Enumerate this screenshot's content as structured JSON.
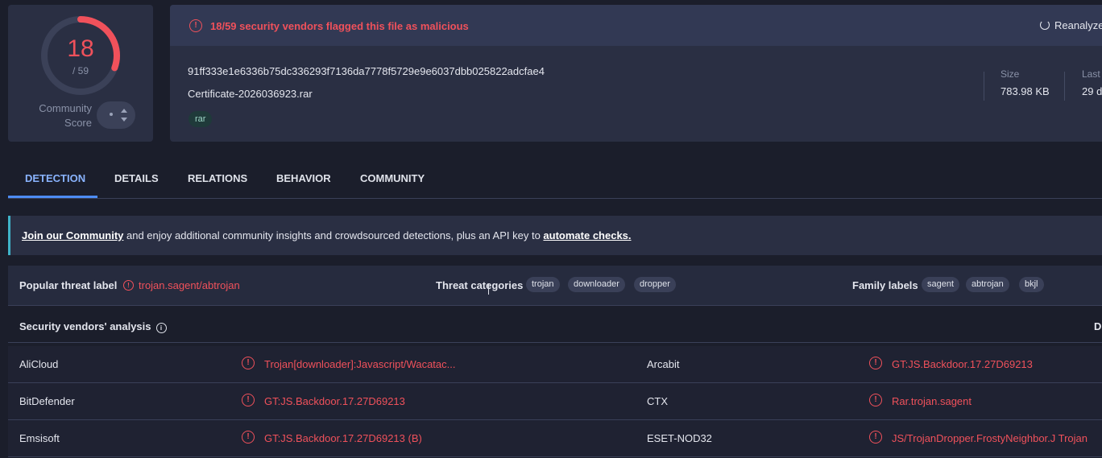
{
  "score": {
    "detected": "18",
    "total": "/ 59",
    "community_label": "Community Score",
    "detected_ratio": 0.3051
  },
  "banner": {
    "text": "18/59 security vendors flagged this file as malicious",
    "reanalyze": "Reanalyze"
  },
  "file": {
    "hash": "91ff333e1e6336b75dc336293f7136da7778f5729e9e6037dbb025822adcfae4",
    "name": "Certificate-2026036923.rar",
    "tag": "rar",
    "size_label": "Size",
    "size_value": "783.98 KB",
    "last_label": "Last",
    "last_value": "29 d"
  },
  "tabs": [
    "DETECTION",
    "DETAILS",
    "RELATIONS",
    "BEHAVIOR",
    "COMMUNITY"
  ],
  "join": {
    "link1": "Join our Community",
    "middle": " and enjoy additional community insights and crowdsourced detections, plus an API key to ",
    "link2": "automate checks."
  },
  "threat": {
    "popular_label": "Popular threat label",
    "popular_value": "trojan.sagent/abtrojan",
    "categories_label": "Threat categories",
    "categories": [
      "trojan",
      "downloader",
      "dropper"
    ],
    "family_label": "Family labels",
    "families": [
      "sagent",
      "abtrojan",
      "bkjl"
    ]
  },
  "vendors": {
    "title": "Security vendors' analysis",
    "right_header": "D",
    "rows": [
      {
        "vendor1": "AliCloud",
        "result1": "Trojan[downloader]:Javascript/Wacatac...",
        "vendor2": "Arcabit",
        "result2": "GT:JS.Backdoor.17.27D69213"
      },
      {
        "vendor1": "BitDefender",
        "result1": "GT:JS.Backdoor.17.27D69213",
        "vendor2": "CTX",
        "result2": "Rar.trojan.sagent"
      },
      {
        "vendor1": "Emsisoft",
        "result1": "GT:JS.Backdoor.17.27D69213 (B)",
        "vendor2": "ESET-NOD32",
        "result2": "JS/TrojanDropper.FrostyNeighbor.J Trojan"
      }
    ]
  },
  "colors": {
    "accent": "#4d8cf5",
    "danger": "#f0515b",
    "panel": "#2a2f43",
    "background": "#1b1e2b"
  }
}
